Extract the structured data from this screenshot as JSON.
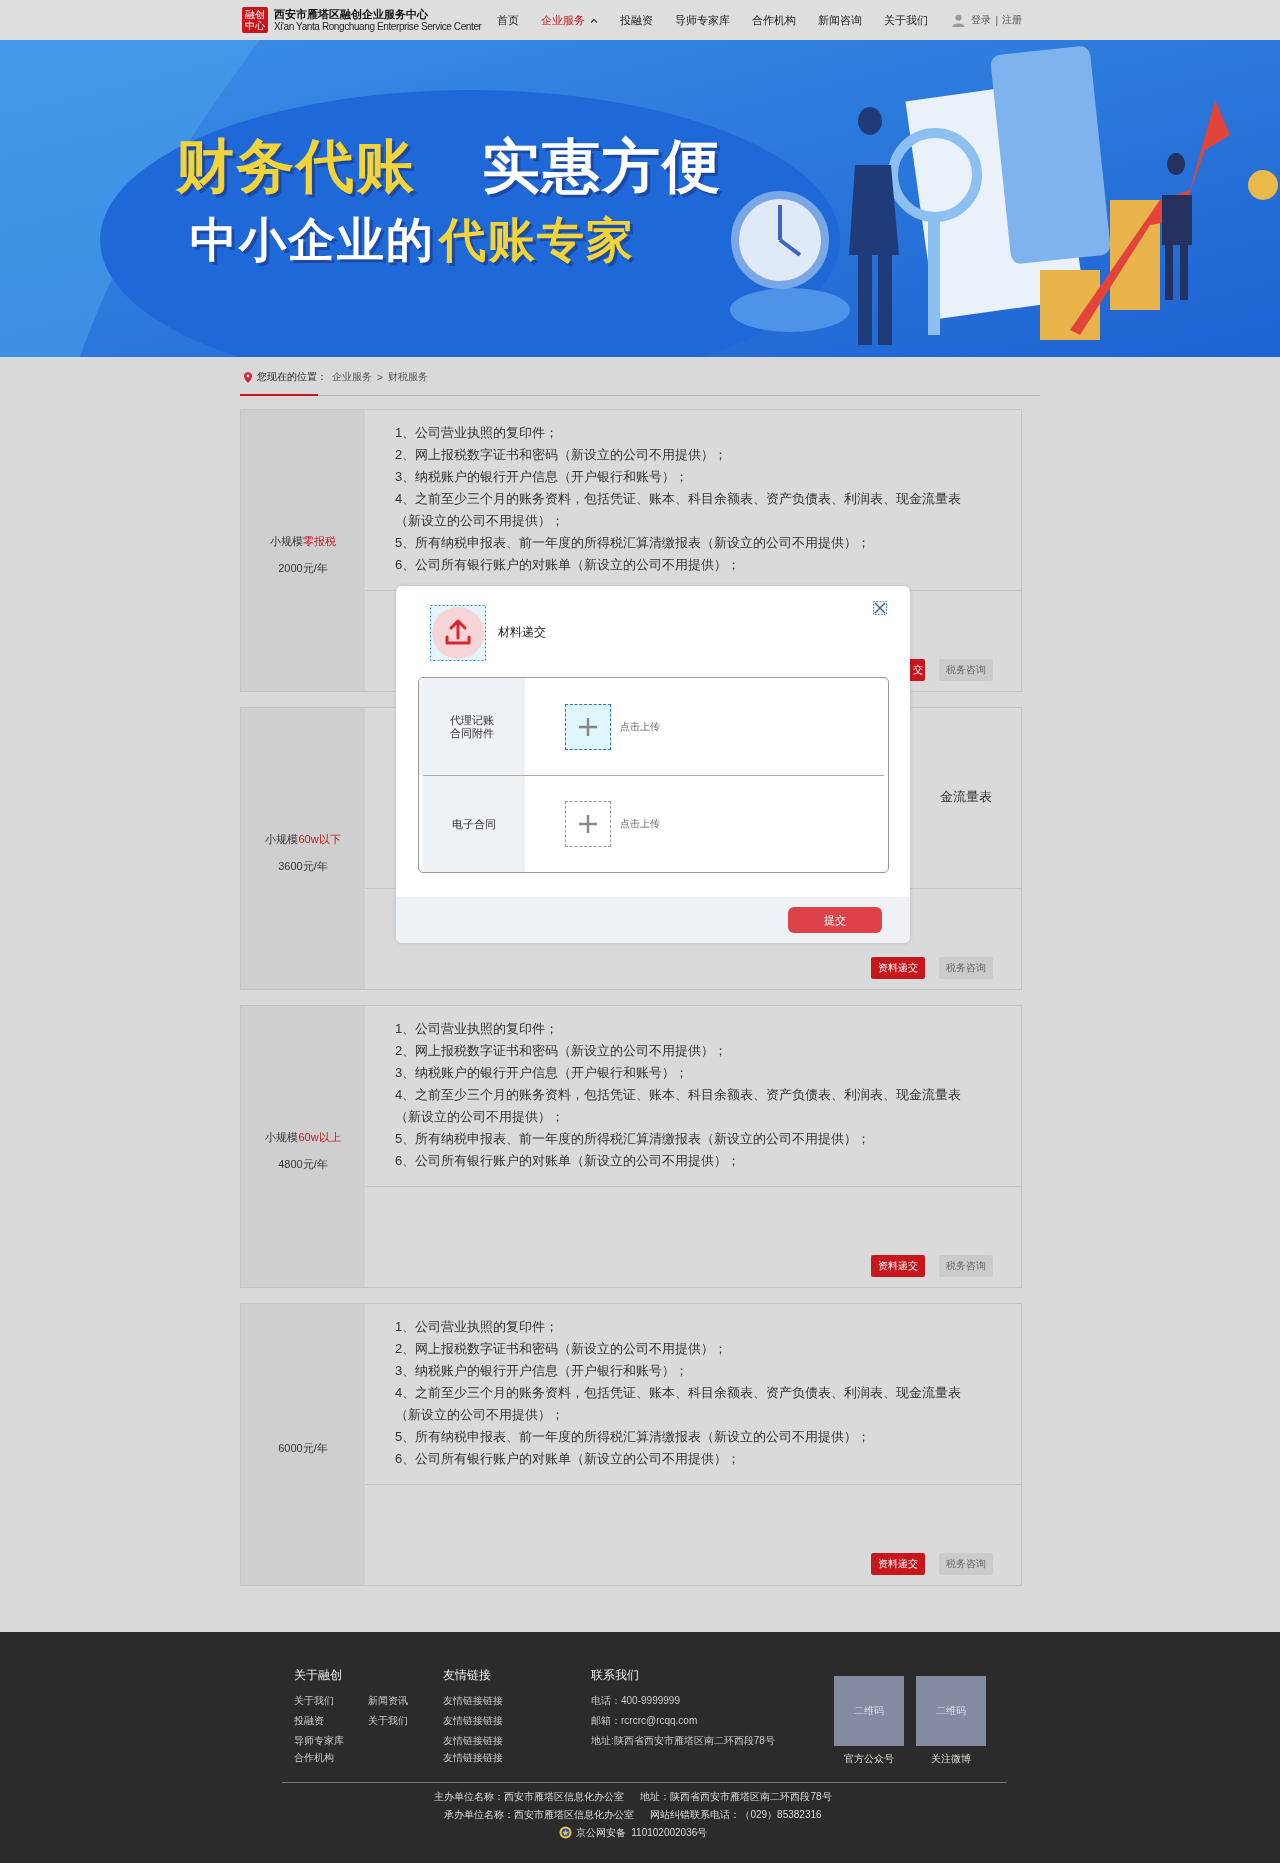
{
  "header": {
    "logo_mark": [
      "融创",
      "中心"
    ],
    "logo_title": "西安市雁塔区融创企业服务中心",
    "logo_subtitle": "Xi'an Yanta Rongchuang Enterprise Service Center",
    "nav": [
      {
        "label": "首页",
        "selected": false,
        "dropdown": false
      },
      {
        "label": "企业服务",
        "selected": true,
        "dropdown": true
      },
      {
        "label": "投融资",
        "selected": false,
        "dropdown": false
      },
      {
        "label": "导师专家库",
        "selected": false,
        "dropdown": false
      },
      {
        "label": "合作机构",
        "selected": false,
        "dropdown": false
      },
      {
        "label": "新闻咨询",
        "selected": false,
        "dropdown": false
      },
      {
        "label": "关于我们",
        "selected": false,
        "dropdown": false
      }
    ],
    "login": "登录",
    "separator": "|",
    "register": "注册"
  },
  "banner": {
    "headline": [
      {
        "text": "财务代账",
        "highlight": true
      },
      {
        "text": "实惠方便",
        "highlight": false
      }
    ],
    "subline": [
      {
        "text": "中小企业的",
        "highlight": false
      },
      {
        "text": "代账专家",
        "highlight": true
      }
    ]
  },
  "breadcrumb": {
    "label": "您现在的位置：",
    "path": [
      "企业服务",
      "财税服务"
    ],
    "separator": ">"
  },
  "cards": [
    {
      "tier": "小规模",
      "tier_highlight": "零报税",
      "price": "2000元/年",
      "items": [
        "1、公司营业执照的复印件；",
        "2、网上报税数字证书和密码（新设立的公司不用提供）；",
        "3、纳税账户的银行开户信息（开户银行和账号）；",
        "4、之前至少三个月的账务资料，包括凭证、账本、科目余额表、资产负债表、利润表、现金流量表（新设立的公司不用提供）；",
        "5、所有纳税申报表、前一年度的所得税汇算清缴报表（新设立的公司不用提供）；",
        "6、公司所有银行账户的对账单（新设立的公司不用提供）；"
      ],
      "buttons": [
        {
          "label": "交",
          "kind": "primary",
          "clipped": true
        },
        {
          "label": "税务咨询",
          "kind": "secondary",
          "clipped": false
        }
      ]
    },
    {
      "tier": "小规模",
      "tier_highlight": "60w以下",
      "price": "3600元/年",
      "fragment": "金流量表",
      "buttons": [
        {
          "label": "资料递交",
          "kind": "primary",
          "clipped": false
        },
        {
          "label": "税务咨询",
          "kind": "secondary",
          "clipped": false
        }
      ]
    },
    {
      "tier": "小规模",
      "tier_highlight": "60w以上",
      "price": "4800元/年",
      "items": [
        "1、公司营业执照的复印件；",
        "2、网上报税数字证书和密码（新设立的公司不用提供）；",
        "3、纳税账户的银行开户信息（开户银行和账号）；",
        "4、之前至少三个月的账务资料，包括凭证、账本、科目余额表、资产负债表、利润表、现金流量表（新设立的公司不用提供）；",
        "5、所有纳税申报表、前一年度的所得税汇算清缴报表（新设立的公司不用提供）；",
        "6、公司所有银行账户的对账单（新设立的公司不用提供）；"
      ],
      "buttons": [
        {
          "label": "资料递交",
          "kind": "primary",
          "clipped": false
        },
        {
          "label": "税务咨询",
          "kind": "secondary",
          "clipped": false
        }
      ]
    },
    {
      "price": "6000元/年",
      "items": [
        "1、公司营业执照的复印件；",
        "2、网上报税数字证书和密码（新设立的公司不用提供）；",
        "3、纳税账户的银行开户信息（开户银行和账号）；",
        "4、之前至少三个月的账务资料，包括凭证、账本、科目余额表、资产负债表、利润表、现金流量表（新设立的公司不用提供）；",
        "5、所有纳税申报表、前一年度的所得税汇算清缴报表（新设立的公司不用提供）；",
        "6、公司所有银行账户的对账单（新设立的公司不用提供）；"
      ],
      "buttons": [
        {
          "label": "资料递交",
          "kind": "primary",
          "clipped": false
        },
        {
          "label": "税务咨询",
          "kind": "secondary",
          "clipped": false
        }
      ]
    }
  ],
  "dialog": {
    "title": "材料递交",
    "rows": [
      {
        "label": "代理记账合同附件",
        "hint": "点击上传",
        "active": true
      },
      {
        "label": "电子合同",
        "hint": "点击上传",
        "active": false
      }
    ],
    "submit": "提交"
  },
  "footer": {
    "about": {
      "title": "关于融创",
      "links": [
        [
          "关于我们",
          "投融资",
          "导师专家库",
          "合作机构"
        ],
        [
          "新闻资讯",
          "关于我们"
        ]
      ]
    },
    "friends": {
      "title": "友情链接",
      "links": [
        "友情链接链接",
        "友情链接链接",
        "友情链接链接",
        "友情链接链接"
      ]
    },
    "contact": {
      "title": "联系我们",
      "lines": [
        "电话：400-9999999",
        "邮箱：rcrcrc@rcqq.com",
        "地址:陕西省西安市雁塔区南二环西段78号"
      ]
    },
    "qr": [
      {
        "label": "二维码",
        "caption": "官方公众号"
      },
      {
        "label": "二维码",
        "caption": "关注微博"
      }
    ],
    "legal": [
      [
        "主办单位名称：西安市雁塔区信息化办公室",
        "地址：陕西省西安市雁塔区南二环西段78号"
      ],
      [
        "承办单位名称：西安市雁塔区信息化办公室",
        "网站纠错联系电话：（029）85382316"
      ]
    ],
    "record": "京公网安备  110102002036号"
  }
}
